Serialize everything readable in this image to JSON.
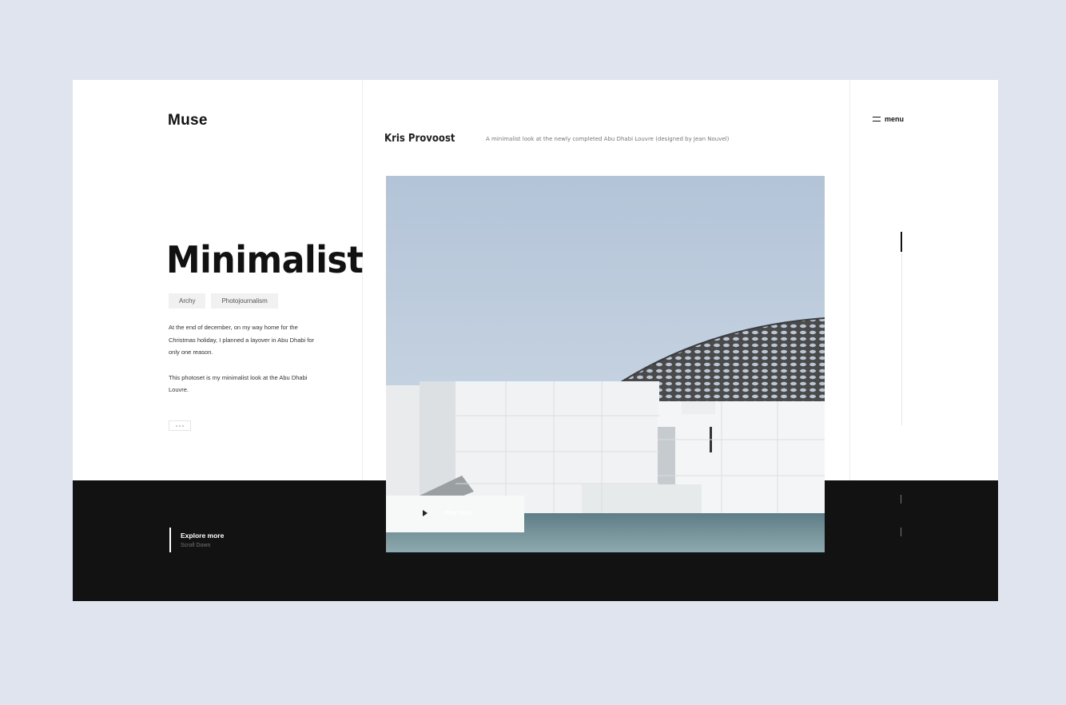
{
  "brand": {
    "logo": "Muse",
    "menu_label": "menu",
    "menu_icon": "hamburger-icon"
  },
  "header": {
    "author": "Kris Provoost",
    "caption": "A minimalist look at the newly completed Abu Dhabi Louvre (designed by Jean Nouvel)"
  },
  "hero": {
    "title": "Minimalist",
    "tags": [
      "Archy",
      "Photojournalism"
    ],
    "paragraphs": [
      "At the end of december, on my way home for the Christmas holiday, I planned a layover in Abu Dhabi for only one reason.",
      "This photoset is my minimalist look at the Abu Dhabi Louvre."
    ],
    "more_icon": "more-dots-icon"
  },
  "footer": {
    "explore_title": "Explore more",
    "explore_sub": "Scroll Down"
  },
  "media": {
    "play_bold": "Play",
    "play_rest": " Video",
    "play_icon": "play-icon"
  },
  "colors": {
    "background": "#dfe4ee",
    "dark_band": "#121212",
    "card": "#ffffff",
    "text": "#111111"
  }
}
